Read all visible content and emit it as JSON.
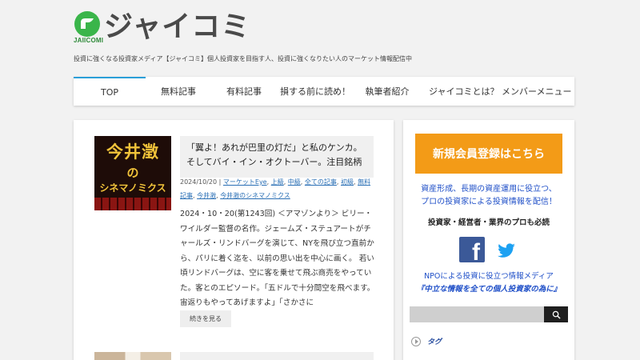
{
  "site": {
    "logo_text": "ジャイコミ",
    "logo_sub": "JAIICOMI",
    "tagline": "投資に強くなる投資家メディア【ジャイコミ】個人投資家を目指す人、投資に強くなりたい人のマーケット情報配信中"
  },
  "nav": {
    "items": [
      {
        "label": "TOP"
      },
      {
        "label": "無料記事"
      },
      {
        "label": "有料記事"
      },
      {
        "label": "損する前に読め！"
      },
      {
        "label": "執筆者紹介"
      },
      {
        "label": "ジャイコミとは？  メンバーメニュー"
      }
    ],
    "accent": "#2a9fd8"
  },
  "article": {
    "thumb": {
      "line1": "今井澂",
      "line2": "の",
      "line3": "シネマノミクス"
    },
    "title": "「翼よ！あれが巴里の灯だ」と私のケンカ。そしてバイ・イン・オクトーバー。注目銘柄",
    "date": "2024/10/20",
    "sep": " | ",
    "categories": [
      "マーケットEye",
      "上級",
      "中級",
      "全ての記事",
      "初級",
      "無料記事",
      "今井澂",
      "今井澂のシネマノミクス"
    ],
    "excerpt": "2024・10・20(第1243回) ＜アマゾンより＞ ビリー・ワイルダー監督の名作。ジェームズ・ステュアートがチャールズ・リンドバーグを演じて、NYを飛び立つ直前から、パリに着く迄を、以前の思い出を中心に画く。 若い頃リンドバーグは、空に客を乗せて飛ぶ商売をやっていた。客とのエピソード。「五ドルで十分間空を飛べます。宙返りもやってあげますよ」「さかさに",
    "more_label": "続きを見る"
  },
  "sidebar": {
    "signup_label": "新規会員登録はこちら",
    "signup_color": "#f39b17",
    "promo1_line1": "資産形成、長期の資産運用に役立つ、",
    "promo1_line2": "プロの投資家による投資情報を配信！",
    "promo2": "投資家・経営者・業界のプロも必読",
    "facebook_icon": "f",
    "promo3_line1": "NPOによる投資に役立つ情報メディア",
    "promo3_line2": "『中立な情報を全ての個人投資家の為に』",
    "search_placeholder": "",
    "tag_label": "タグ"
  }
}
